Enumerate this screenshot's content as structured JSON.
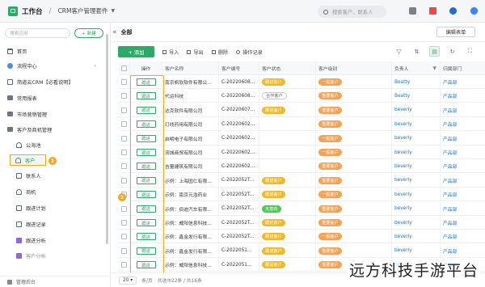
{
  "topbar": {
    "app_title": "工作台",
    "separator": "/",
    "crm_title": "CRM客户管理套件",
    "search_placeholder": "搜索客户、联系人"
  },
  "sidebar": {
    "search_placeholder": "搜索应用",
    "new_label": "+ 新建",
    "items": [
      {
        "label": "首页",
        "icon": "home-icon"
      },
      {
        "label": "流程中心",
        "icon": "flow-icon"
      },
      {
        "label": "简道云CRM【必看说明】",
        "icon": "doc-icon"
      },
      {
        "label": "常用报表",
        "icon": "folder-icon"
      },
      {
        "label": "市场营销管理",
        "icon": "folder-icon"
      },
      {
        "label": "客户及商机管理",
        "icon": "folder-icon"
      },
      {
        "label": "公海池",
        "icon": "person-icon"
      },
      {
        "label": "客户",
        "icon": "person-icon"
      },
      {
        "label": "联系人",
        "icon": "grid-icon"
      },
      {
        "label": "商机",
        "icon": "person-icon"
      },
      {
        "label": "跟进计划",
        "icon": "grid-icon"
      },
      {
        "label": "跟进记录",
        "icon": "grid-icon"
      },
      {
        "label": "跟进分析",
        "icon": "chart-icon"
      },
      {
        "label": "客户分析",
        "icon": "chart-icon"
      }
    ],
    "bottom_label": "管理后台",
    "badge1": "1"
  },
  "main": {
    "view_title": "全部",
    "edit_form_label": "编辑表单",
    "toolbar": {
      "add": "+ 添加",
      "import": "导入",
      "export": "导出",
      "delete": "删除",
      "log": "操作记录"
    },
    "badge2": "2",
    "columns": [
      "操作",
      "客户名称",
      "客户编号",
      "客户状态",
      "客户级别",
      "负责人",
      "归属部门"
    ],
    "rows": [
      {
        "op": "跟进",
        "name": "南京帆软软件有限公...",
        "no": "C-20220608...",
        "status": "跟进客户",
        "status_type": "yellow",
        "level": "一般客户",
        "level_type": "orange",
        "owner": "Beatty",
        "dept": "产品部"
      },
      {
        "op": "跟进",
        "name": "代运科技",
        "no": "C-20220608...",
        "status": "合作客户",
        "status_type": "outline",
        "level": "重要客户",
        "level_type": "orange",
        "owner": "Beatty",
        "dept": "产品部"
      },
      {
        "op": "跟进",
        "name": "达克软件有限公司",
        "no": "C-20220607...",
        "status": "跟进客户",
        "status_type": "yellow",
        "level": "重要客户",
        "level_type": "orange",
        "owner": "beverly",
        "dept": "产品部"
      },
      {
        "op": "跟进",
        "name": "玎线药用有限公司",
        "no": "C-20220602...",
        "status": "",
        "status_type": "",
        "level": "重要客户",
        "level_type": "orange",
        "owner": "beverly",
        "dept": "产品部"
      },
      {
        "op": "跟进",
        "name": "启明电子有限公司",
        "no": "C-20220602...",
        "status": "",
        "status_type": "",
        "level": "一般客户",
        "level_type": "orange",
        "owner": "beverly",
        "dept": "产品部"
      },
      {
        "op": "跟进",
        "name": "流城商贸有限公司",
        "no": "C-20220602...",
        "status": "",
        "status_type": "",
        "level": "一般客户",
        "level_type": "orange",
        "owner": "beverly",
        "dept": "产品部"
      },
      {
        "op": "跟进",
        "name": "吉量建筑有限公司",
        "no": "C-20220602...",
        "status": "",
        "status_type": "",
        "level": "重要客户",
        "level_type": "orange",
        "owner": "beverly",
        "dept": "产品部"
      },
      {
        "op": "跟进",
        "name": "示例：上海国仁有限...",
        "no": "C-2022052T...",
        "status": "跟进客户",
        "status_type": "yellow",
        "level": "重要客户",
        "level_type": "orange",
        "owner": "beverly",
        "dept": "产品部"
      },
      {
        "op": "跟进",
        "name": "示例：南京元浩药业",
        "no": "C-2022052T...",
        "status": "跟进客户",
        "status_type": "yellow",
        "level": "一般客户",
        "level_type": "orange",
        "owner": "beverly",
        "dept": "产品部"
      },
      {
        "op": "跟进",
        "name": "示例：佰迪汽车有限...",
        "no": "C-2022052T...",
        "status": "无意向",
        "status_type": "green",
        "level": "重要客户",
        "level_type": "orange",
        "owner": "beverly",
        "dept": "产品部"
      },
      {
        "op": "跟进",
        "name": "示例：威阳信息科技...",
        "no": "C-2022052T...",
        "status": "跟进客户",
        "status_type": "yellow",
        "level": "重要客户",
        "level_type": "orange",
        "owner": "beverly",
        "dept": "产品部"
      },
      {
        "op": "跟进",
        "name": "示例：鑫金发行有限...",
        "no": "C-2022052T...",
        "status": "跟进客户",
        "status_type": "yellow",
        "level": "一般客户",
        "level_type": "orange",
        "owner": "beverly",
        "dept": "产品部"
      },
      {
        "op": "跟进",
        "name": "示例：鑫金发行有限...",
        "no": "C-2022051...",
        "status": "跟进客户",
        "status_type": "yellow",
        "level": "重要客户",
        "level_type": "orange",
        "owner": "beverly",
        "dept": "产品部"
      },
      {
        "op": "跟进",
        "name": "示例：威阳信息科技...",
        "no": "C-2022051...",
        "status": "跟进客户",
        "status_type": "yellow",
        "level": "重要客户",
        "level_type": "orange",
        "owner": "beverly",
        "dept": "产品部"
      }
    ],
    "footer": {
      "page_size": "20",
      "page_size_unit": "条/页",
      "summary": "共选中22条 / 共16条"
    }
  },
  "watermark": "远方科技手游平台",
  "colors": {
    "brand": "#2fa968",
    "highlight": "#f5a623"
  }
}
